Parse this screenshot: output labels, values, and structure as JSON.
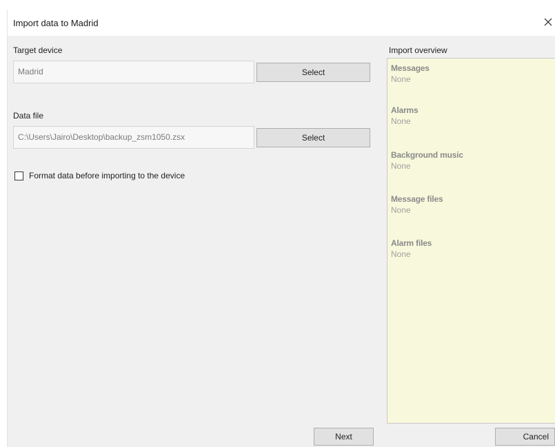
{
  "dialog": {
    "title": "Import data to Madrid",
    "close_icon": "close-icon"
  },
  "target_device": {
    "label": "Target device",
    "value": "Madrid",
    "select_label": "Select"
  },
  "data_file": {
    "label": "Data file",
    "value": "C:\\Users\\Jairo\\Desktop\\backup_zsm1050.zsx",
    "select_label": "Select"
  },
  "format_option": {
    "label": "Format data before importing to the device",
    "checked": false
  },
  "overview": {
    "label": "Import overview",
    "sections": [
      {
        "title": "Messages",
        "value": "None"
      },
      {
        "title": "Alarms",
        "value": "None"
      },
      {
        "title": "Background music",
        "value": "None"
      },
      {
        "title": "Message files",
        "value": "None"
      },
      {
        "title": "Alarm files",
        "value": "None"
      }
    ]
  },
  "footer": {
    "next_label": "Next",
    "cancel_label": "Cancel"
  },
  "colors": {
    "overview_bg": "#f8f9dc",
    "dialog_bg": "#f0f0f0"
  }
}
